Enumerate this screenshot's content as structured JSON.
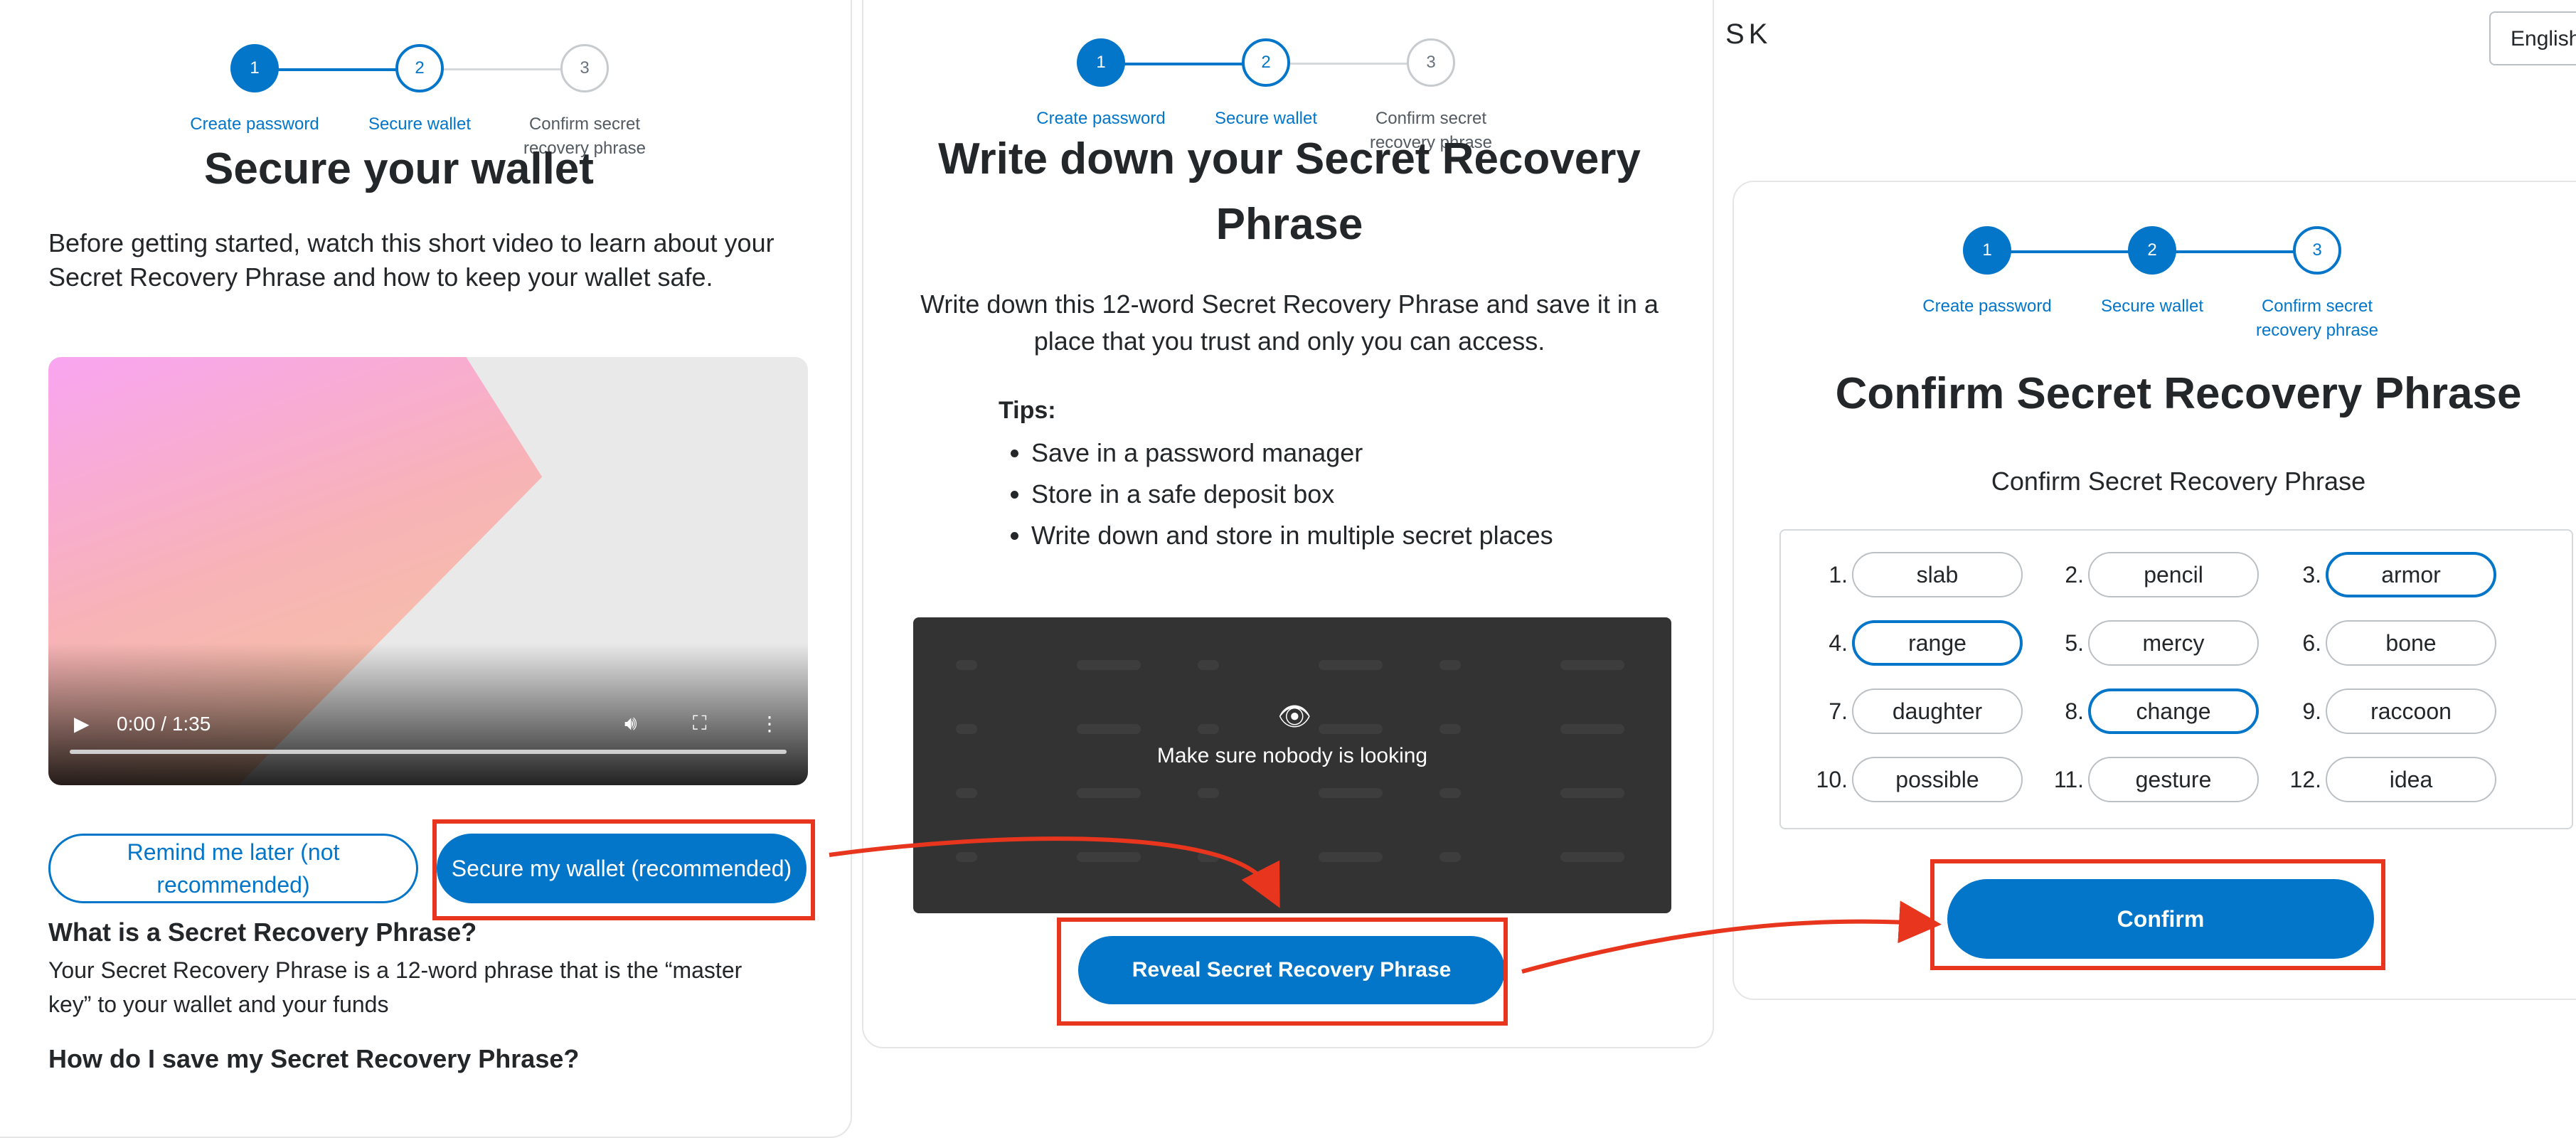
{
  "steps": {
    "labels": [
      "Create password",
      "Secure wallet",
      "Confirm secret\nrecovery phrase"
    ],
    "numbers": [
      "1",
      "2",
      "3"
    ]
  },
  "panel1": {
    "title": "Secure your wallet",
    "intro": "Before getting started, watch this short video to learn about your Secret Recovery Phrase and how to keep your wallet safe.",
    "video_time": "0:00 / 1:35",
    "remind_label": "Remind me later (not recommended)",
    "secure_label": "Secure my wallet (recommended)",
    "q1": "What is a Secret Recovery Phrase?",
    "a1": "Your Secret Recovery Phrase is a 12-word phrase that is the “master key” to your wallet and your funds",
    "q2": "How do I save my Secret Recovery Phrase?"
  },
  "panel2": {
    "title": "Write down your Secret Recovery Phrase",
    "intro": "Write down this 12-word Secret Recovery Phrase and save it in a place that you trust and only you can access.",
    "tips_title": "Tips:",
    "tips": [
      "Save in a password manager",
      "Store in a safe deposit box",
      "Write down and store in multiple secret places"
    ],
    "overlay_text": "Make sure nobody is looking",
    "reveal_label": "Reveal Secret Recovery Phrase"
  },
  "panel3": {
    "title": "Confirm Secret Recovery Phrase",
    "subtitle": "Confirm Secret Recovery Phrase",
    "words": [
      {
        "num": "1.",
        "word": "slab",
        "active": false
      },
      {
        "num": "2.",
        "word": "pencil",
        "active": false
      },
      {
        "num": "3.",
        "word": "armor",
        "active": true
      },
      {
        "num": "4.",
        "word": "range",
        "active": true
      },
      {
        "num": "5.",
        "word": "mercy",
        "active": false
      },
      {
        "num": "6.",
        "word": "bone",
        "active": false
      },
      {
        "num": "7.",
        "word": "daughter",
        "active": false
      },
      {
        "num": "8.",
        "word": "change",
        "active": true
      },
      {
        "num": "9.",
        "word": "raccoon",
        "active": false
      },
      {
        "num": "10.",
        "word": "possible",
        "active": false
      },
      {
        "num": "11.",
        "word": "gesture",
        "active": false
      },
      {
        "num": "12.",
        "word": "idea",
        "active": false
      }
    ],
    "confirm_label": "Confirm"
  },
  "header": {
    "initials": "SK",
    "language": "English"
  },
  "colors": {
    "accent": "#0376c9",
    "annotation": "#e8351d"
  }
}
